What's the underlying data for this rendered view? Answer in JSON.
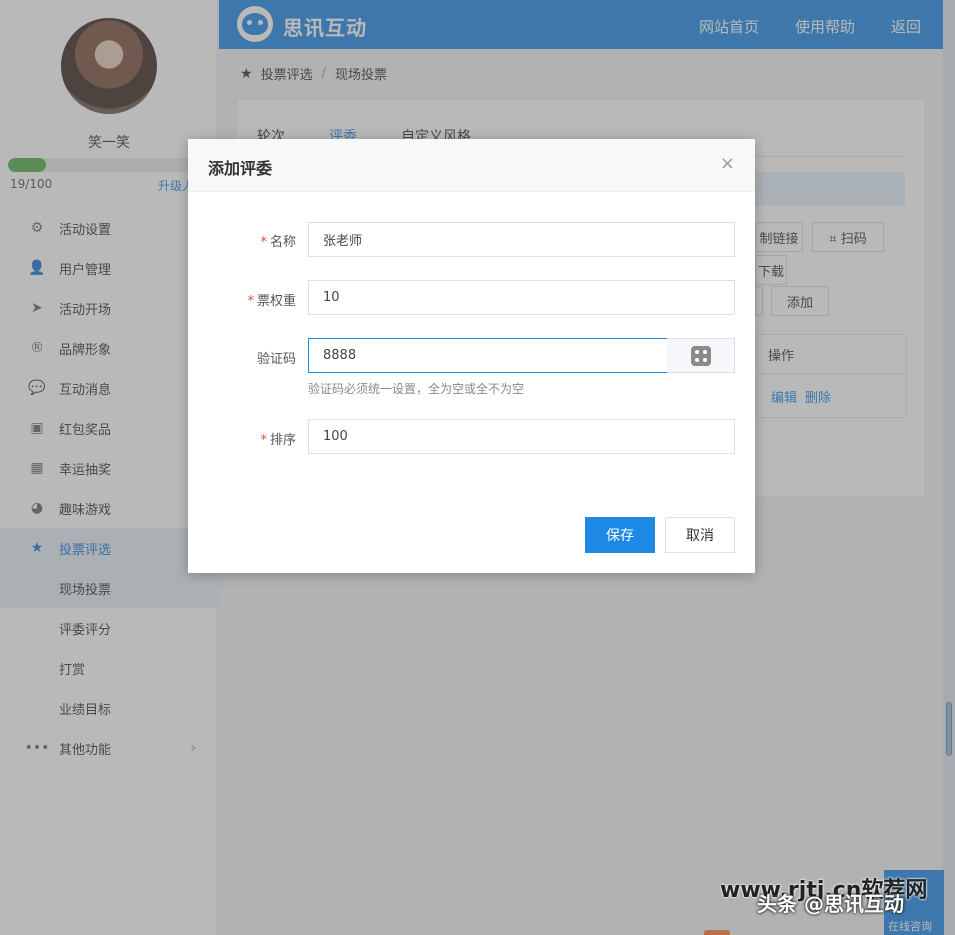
{
  "user": {
    "name": "笑一笑",
    "progress_text": "19/100",
    "progress_fraction": 0.19,
    "upgrade": "升级人数"
  },
  "sidebar": {
    "items": [
      {
        "label": "活动设置",
        "icon": "gear-icon"
      },
      {
        "label": "用户管理",
        "icon": "user-icon"
      },
      {
        "label": "活动开场",
        "icon": "paper-plane-icon"
      },
      {
        "label": "品牌形象",
        "icon": "registered-icon"
      },
      {
        "label": "互动消息",
        "icon": "chat-icon"
      },
      {
        "label": "红包奖品",
        "icon": "gift-icon"
      },
      {
        "label": "幸运抽奖",
        "icon": "lottery-icon"
      },
      {
        "label": "趣味游戏",
        "icon": "game-icon"
      },
      {
        "label": "投票评选",
        "icon": "star-icon"
      }
    ],
    "submenu": [
      {
        "label": "现场投票"
      },
      {
        "label": "评委评分"
      },
      {
        "label": "打赏"
      },
      {
        "label": "业绩目标"
      }
    ],
    "more": {
      "label": "其他功能"
    }
  },
  "header": {
    "logo_text": "思讯互动",
    "nav": {
      "home": "网站首页",
      "help": "使用帮助",
      "back": "返回"
    }
  },
  "breadcrumb": {
    "parent": "投票评选",
    "current": "现场投票",
    "separator": "/"
  },
  "tabs": [
    {
      "label": "轮次"
    },
    {
      "label": "评委"
    },
    {
      "label": "自定义风格"
    }
  ],
  "toolbar": {
    "copy_link": "制链接",
    "scan": "⌗ 扫码",
    "download": "下载",
    "add": "添加"
  },
  "table": {
    "header_op": "操作",
    "row_edit": "编辑",
    "row_delete": "删除"
  },
  "modal": {
    "title": "添加评委",
    "close": "×",
    "fields": {
      "name": {
        "label": "名称",
        "value": "张老师"
      },
      "weight": {
        "label": "票权重",
        "value": "10"
      },
      "code": {
        "label": "验证码",
        "value": "8888",
        "hint": "验证码必须统一设置，全为空或全不为空"
      },
      "order": {
        "label": "排序",
        "value": "100"
      }
    },
    "save": "保存",
    "cancel": "取消"
  },
  "widget": {
    "chat_label": "在线咨询"
  },
  "watermark": {
    "site": "www.rjtj.cn软荐网",
    "toutiao": "头条 @思讯互动"
  },
  "colors": {
    "primary": "#1e88e5",
    "progress": "#52b04b",
    "required": "#e84c3d"
  }
}
